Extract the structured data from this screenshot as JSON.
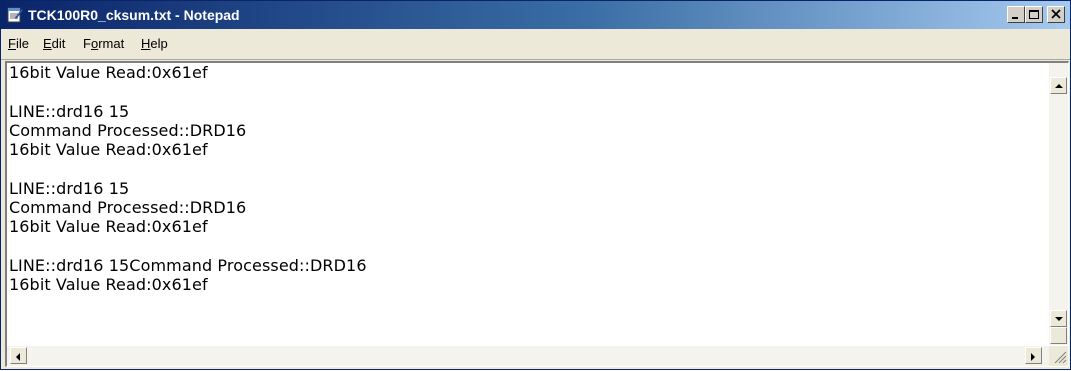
{
  "window": {
    "title": "TCK100R0_cksum.txt - Notepad",
    "controls": {
      "minimize": "minimize",
      "maximize": "maximize",
      "close": "close"
    }
  },
  "menu": {
    "items": [
      {
        "label": "File",
        "accel_index": 0
      },
      {
        "label": "Edit",
        "accel_index": 0
      },
      {
        "label": "Format",
        "accel_index": 1
      },
      {
        "label": "Help",
        "accel_index": 0
      }
    ]
  },
  "document": {
    "content": "16bit Value Read:0x61ef\n\nLINE::drd16 15\nCommand Processed::DRD16\n16bit Value Read:0x61ef\n\nLINE::drd16 15\nCommand Processed::DRD16\n16bit Value Read:0x61ef\n\nLINE::drd16 15Command Processed::DRD16\n16bit Value Read:0x61ef"
  },
  "icons": {
    "app": "notepad-icon",
    "scroll_up": "arrow-up-icon",
    "scroll_down": "arrow-down-icon",
    "scroll_left": "arrow-left-icon",
    "scroll_right": "arrow-right-icon",
    "resize": "size-grip-icon"
  },
  "colors": {
    "titlebar_start": "#0a246a",
    "titlebar_end": "#a6caf0",
    "chrome": "#ece9d8"
  }
}
